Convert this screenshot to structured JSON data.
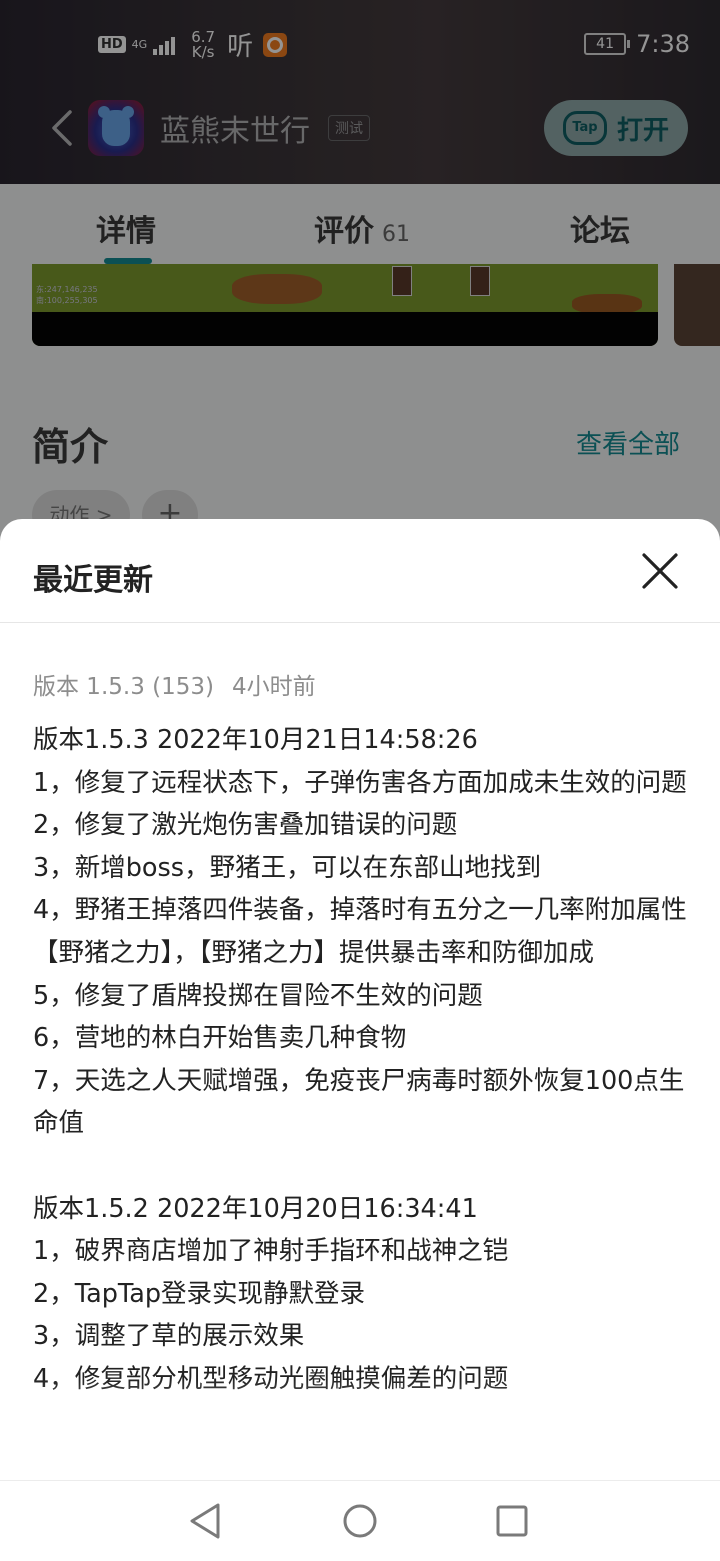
{
  "status_bar": {
    "hd": "HD",
    "network": "4G",
    "speed_value": "6.7",
    "speed_unit": "K/s",
    "listen_glyph": "听",
    "battery": "41",
    "time": "7:38"
  },
  "app_header": {
    "title": "蓝熊末世行",
    "tag": "测试",
    "open_button": "打开",
    "tap_logo": "Tap"
  },
  "tabs": [
    {
      "label": "详情",
      "active": true
    },
    {
      "label": "评价",
      "count": "61"
    },
    {
      "label": "论坛"
    }
  ],
  "screenshot_stats": [
    "东:247,146,235",
    "南:100,255,305"
  ],
  "intro": {
    "title": "简介",
    "see_all": "查看全部",
    "tag_chip": "动作 >",
    "add_chip": "+"
  },
  "sheet": {
    "title": "最近更新",
    "version_meta": "版本 1.5.3 (153)",
    "version_ago": "4小时前",
    "changelog": [
      "版本1.5.3 2022年10月21日14:58:26",
      "1，修复了远程状态下，子弹伤害各方面加成未生效的问题",
      "2，修复了激光炮伤害叠加错误的问题",
      "3，新增boss，野猪王，可以在东部山地找到",
      "4，野猪王掉落四件装备，掉落时有五分之一几率附加属性【野猪之力】，【野猪之力】提供暴击率和防御加成",
      "5，修复了盾牌投掷在冒险不生效的问题",
      "6，营地的林白开始售卖几种食物",
      "7，天选之人天赋增强，免疫丧尸病毒时额外恢复100点生命值",
      "",
      "版本1.5.2 2022年10月20日16:34:41",
      "1，破界商店增加了神射手指环和战神之铠",
      "2，TapTap登录实现静默登录",
      "3，调整了草的展示效果",
      "4，修复部分机型移动光圈触摸偏差的问题"
    ]
  },
  "nav_bar": {
    "icons": [
      "back-triangle-icon",
      "home-circle-icon",
      "recents-square-icon"
    ]
  },
  "colors": {
    "accent": "#138a91",
    "overlay": "rgba(0,0,0,0.42)"
  }
}
